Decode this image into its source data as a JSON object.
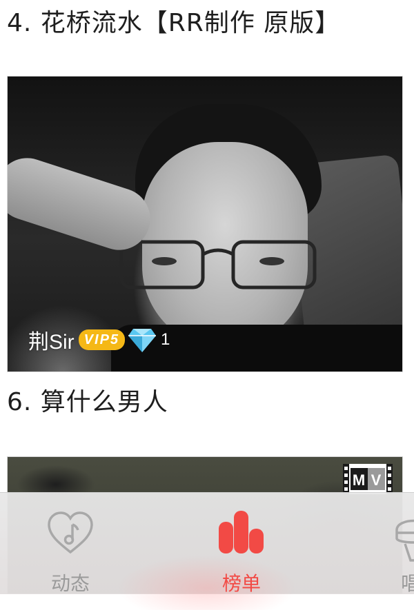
{
  "songs": [
    {
      "title": "4. 花桥流水【RR制作 原版】"
    },
    {
      "title": "6. 算什么男人"
    }
  ],
  "performer": {
    "name": "荆Sir",
    "vip_label": "VIP5",
    "diamond_icon": "diamond-icon",
    "diamond_count": "1"
  },
  "second_card": {
    "badge_icon": "mv-icon",
    "badge_text": "MV"
  },
  "tab_bar": {
    "tabs": [
      {
        "label": "动态",
        "icon": "heart-music-icon",
        "active": false
      },
      {
        "label": "榜单",
        "icon": "bar-chart-icon",
        "active": true
      },
      {
        "label": "唱",
        "icon": "microphone-icon",
        "active": false
      }
    ]
  },
  "colors": {
    "accent": "#f24a45",
    "inactive": "#9a9a9a",
    "vip": "#f5b816",
    "diamond": "#59c7f0"
  }
}
